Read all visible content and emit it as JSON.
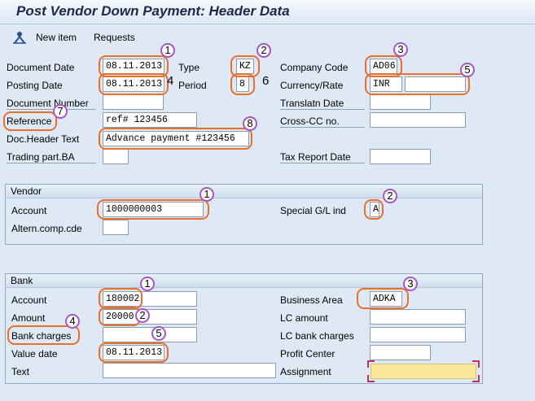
{
  "window": {
    "title": "Post Vendor Down Payment: Header Data"
  },
  "toolbar": {
    "new_item": "New item",
    "requests": "Requests"
  },
  "header": {
    "document_date": {
      "label": "Document Date",
      "value": "08.11.2013"
    },
    "type": {
      "label": "Type",
      "value": "KZ"
    },
    "company_code": {
      "label": "Company Code",
      "value": "AD06"
    },
    "posting_date": {
      "label": "Posting Date",
      "value": "08.11.2013"
    },
    "period": {
      "label": "Period",
      "value": "8"
    },
    "currency_rate": {
      "label": "Currency/Rate",
      "value": "INR",
      "rate": ""
    },
    "document_number": {
      "label": "Document Number",
      "value": ""
    },
    "translatn_date": {
      "label": "Translatn Date",
      "value": ""
    },
    "reference": {
      "label": "Reference",
      "value": "ref# 123456"
    },
    "cross_cc": {
      "label": "Cross-CC no.",
      "value": ""
    },
    "doc_header_text": {
      "label": "Doc.Header Text",
      "value": "Advance payment #123456"
    },
    "trading_part": {
      "label": "Trading part.BA",
      "value": ""
    },
    "tax_report_date": {
      "label": "Tax Report Date",
      "value": ""
    }
  },
  "vendor": {
    "title": "Vendor",
    "account": {
      "label": "Account",
      "value": "1000000003"
    },
    "special_gl": {
      "label": "Special G/L ind",
      "value": "A"
    },
    "altern_comp": {
      "label": "Altern.comp.cde",
      "value": ""
    }
  },
  "bank": {
    "title": "Bank",
    "account": {
      "label": "Account",
      "value": "180002"
    },
    "business_area": {
      "label": "Business Area",
      "value": "ADKA"
    },
    "amount": {
      "label": "Amount",
      "value": "20000"
    },
    "lc_amount": {
      "label": "LC amount",
      "value": ""
    },
    "bank_charges": {
      "label": "Bank charges",
      "value": ""
    },
    "lc_bank_charges": {
      "label": "LC bank charges",
      "value": ""
    },
    "value_date": {
      "label": "Value date",
      "value": "08.11.2013"
    },
    "profit_center": {
      "label": "Profit Center",
      "value": ""
    },
    "text": {
      "label": "Text",
      "value": ""
    },
    "assignment": {
      "label": "Assignment",
      "value": ""
    }
  },
  "annotations": {
    "header": [
      "1",
      "2",
      "3",
      "4",
      "5",
      "6",
      "7",
      "8"
    ],
    "vendor": [
      "1",
      "2"
    ],
    "bank": [
      "1",
      "2",
      "3",
      "4",
      "5"
    ]
  },
  "colors": {
    "highlight_ring": "#e8702d",
    "badge_border": "#a855c8",
    "required_field": "#fbe89b",
    "background": "#dfe9f5"
  }
}
